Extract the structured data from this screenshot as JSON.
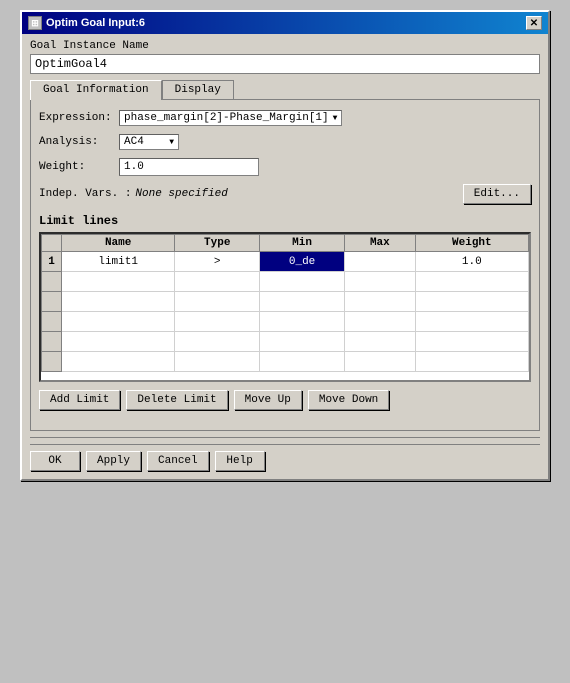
{
  "window": {
    "title": "Optim Goal Input:6",
    "close_button": "✕"
  },
  "form": {
    "goal_instance_name_label": "Goal Instance Name",
    "goal_instance_name_value": "OptimGoal4",
    "tabs": [
      {
        "label": "Goal Information",
        "active": true
      },
      {
        "label": "Display",
        "active": false
      }
    ],
    "expression_label": "Expression:",
    "expression_value": "phase_margin[2]-Phase_Margin[1]",
    "analysis_label": "Analysis:",
    "analysis_value": "AC4",
    "weight_label": "Weight:",
    "weight_value": "1.0",
    "indep_label": "Indep. Vars. :",
    "indep_value": "None specified",
    "edit_button": "Edit...",
    "limit_lines_title": "Limit lines",
    "table": {
      "headers": [
        "Name",
        "Type",
        "Min",
        "Max",
        "Weight"
      ],
      "rows": [
        {
          "row_num": "1",
          "name": "limit1",
          "type": ">",
          "min": "0_de",
          "max": "",
          "weight": "1.0"
        }
      ]
    },
    "add_limit_button": "Add Limit",
    "delete_limit_button": "Delete Limit",
    "move_up_button": "Move Up",
    "move_down_button": "Move Down",
    "ok_button": "OK",
    "apply_button": "Apply",
    "cancel_button": "Cancel",
    "help_button": "Help"
  }
}
